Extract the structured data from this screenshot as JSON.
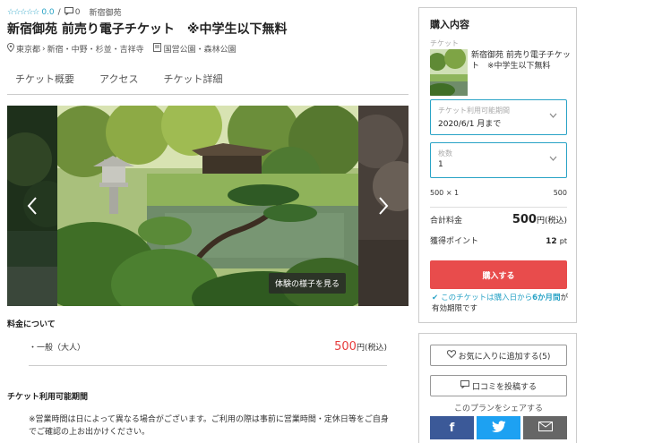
{
  "meta": {
    "stars": "☆☆☆☆☆",
    "rating": "0.0",
    "separator": "/",
    "review_count": "0",
    "area": "新宿御苑"
  },
  "title": "新宿御苑 前売り電子チケット　※中学生以下無料",
  "location": {
    "region": "東京都",
    "area": "新宿・中野・杉並・吉祥寺",
    "category": "国営公園・森林公園"
  },
  "tabs": [
    {
      "label": "チケット概要"
    },
    {
      "label": "アクセス"
    },
    {
      "label": "チケット詳細"
    }
  ],
  "carousel": {
    "view_button": "体験の様子を見る"
  },
  "pricing": {
    "heading": "料金について",
    "items": [
      {
        "label": "・一般（大人）",
        "price": "500",
        "unit": "円(税込)"
      }
    ]
  },
  "period": {
    "heading": "チケット利用可能期間",
    "note": "※営業時間は日によって異なる場合がございます。ご利用の際は事前に営業時間・定休日等をご自身でご確認の上お出かけください。"
  },
  "purchase": {
    "title": "購入内容",
    "ticket_label": "チケット",
    "ticket_name": "新宿御苑 前売り電子チケット　※中学生以下無料",
    "date_field": {
      "label": "チケット利用可能期間",
      "value": "2020/6/1 月まで"
    },
    "qty_field": {
      "label": "枚数",
      "value": "1"
    },
    "calc": {
      "formula": "500 × 1",
      "amount": "500"
    },
    "total": {
      "label": "合計料金",
      "value": "500",
      "unit": "円(税込)"
    },
    "points": {
      "label": "獲得ポイント",
      "value": "12",
      "unit": "pt"
    },
    "buy_button": "購入する",
    "validity": {
      "prefix": "このチケットは購入日から",
      "highlight": "6か月間",
      "suffix": "が有効期限です"
    }
  },
  "actions": {
    "favorite_button": "お気に入りに追加する(5)",
    "review_button": "口コミを投稿する",
    "share_label": "このプランをシェアする",
    "share": [
      {
        "name": "facebook",
        "glyph": "f"
      },
      {
        "name": "twitter",
        "glyph": "t"
      },
      {
        "name": "mail",
        "glyph": "✉"
      }
    ]
  },
  "colors": {
    "accent": "#29a3c6",
    "buy": "#e84c4c",
    "price": "#e63c3c",
    "facebook": "#3b5998",
    "twitter": "#1da1f2",
    "mail": "#666666"
  }
}
